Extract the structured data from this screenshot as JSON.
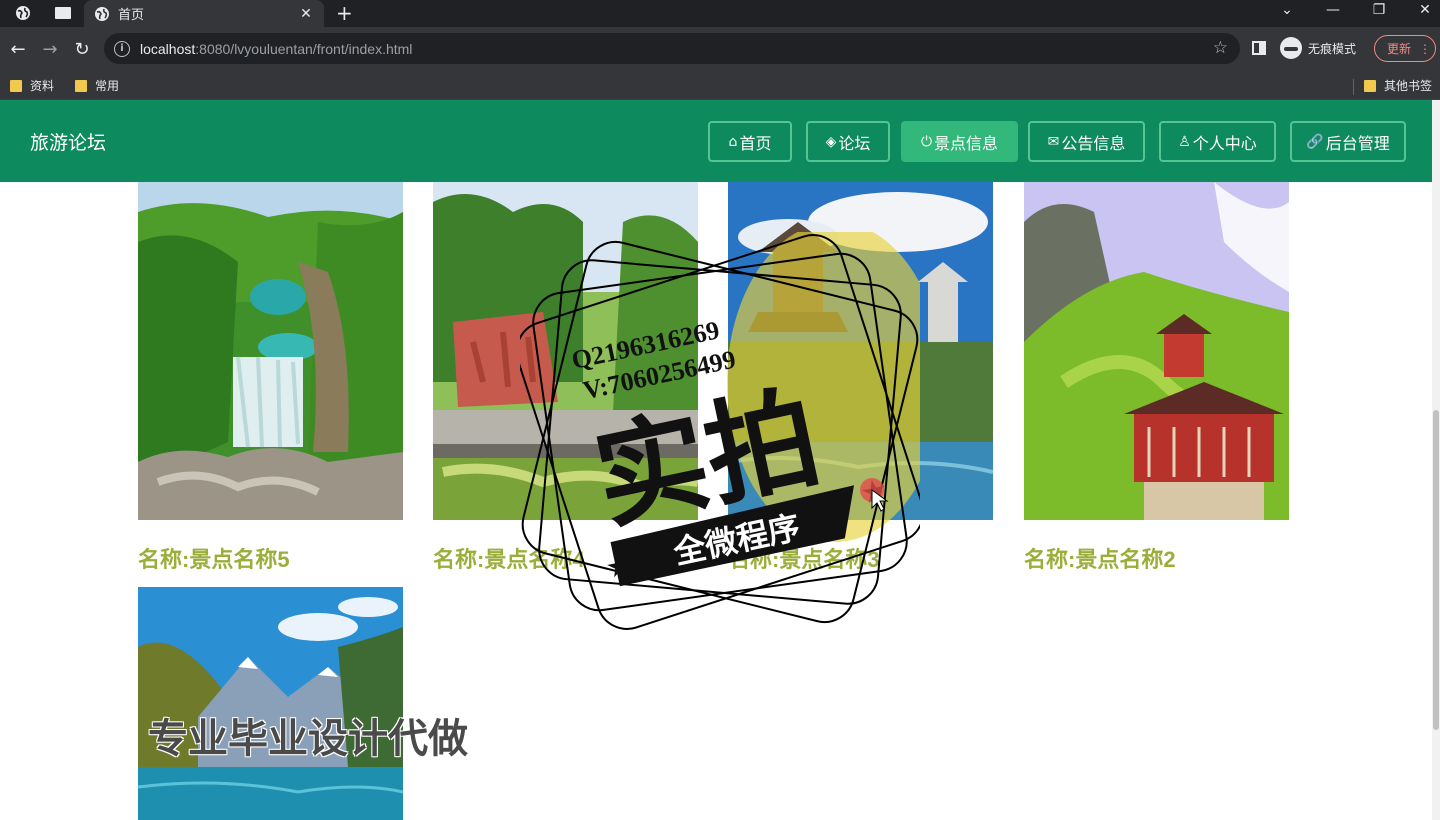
{
  "browser": {
    "tab_title": "首页",
    "url_host": "localhost",
    "url_rest": ":8080/lvyouluentan/front/index.html",
    "incognito_label": "无痕模式",
    "update_label": "更新",
    "bookmarks": [
      "资料",
      "常用"
    ],
    "other_bookmarks": "其他书签"
  },
  "site": {
    "brand": "旅游论坛",
    "nav": [
      {
        "icon": "⌂",
        "label": "首页",
        "active": false
      },
      {
        "icon": "◈",
        "label": "论坛",
        "active": false
      },
      {
        "icon": "⏻",
        "label": "景点信息",
        "active": true
      },
      {
        "icon": "✉",
        "label": "公告信息",
        "active": false
      },
      {
        "icon": "♙",
        "label": "个人中心",
        "active": false
      },
      {
        "icon": "🔗",
        "label": "后台管理",
        "active": false
      }
    ]
  },
  "cards": [
    {
      "name": "名称:景点名称5"
    },
    {
      "name": "名称:景点名称4"
    },
    {
      "name": "名称:景点名称3"
    },
    {
      "name": "名称:景点名称2"
    },
    {
      "name": ""
    }
  ],
  "overlay": {
    "stamp_lines": [
      "Q2196316269",
      "V:7060256499"
    ],
    "stamp_main": "实拍",
    "stamp_banner": "全微程序",
    "caption": "专业毕业设计代做"
  }
}
